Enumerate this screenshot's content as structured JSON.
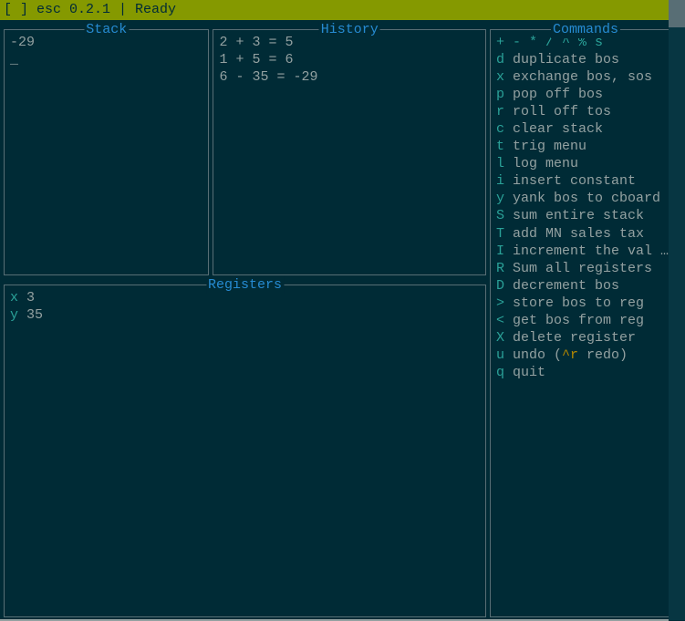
{
  "status": {
    "text": "[ ] esc 0.2.1 | Ready"
  },
  "panels": {
    "stack_title": "Stack",
    "history_title": "History",
    "registers_title": "Registers",
    "commands_title": "Commands"
  },
  "stack": {
    "lines": [
      "-29"
    ],
    "cursor": "_"
  },
  "history": {
    "lines": [
      "2 + 3 = 5",
      "1 + 5 = 6",
      "6 - 35 = -29"
    ]
  },
  "registers": [
    {
      "key": "x",
      "value": "3"
    },
    {
      "key": "y",
      "value": "35"
    }
  ],
  "commands": {
    "operators": "+ - * / ^ % s",
    "items": [
      {
        "key": "d",
        "desc": "duplicate bos"
      },
      {
        "key": "x",
        "desc": "exchange bos, sos"
      },
      {
        "key": "p",
        "desc": "pop off bos"
      },
      {
        "key": "r",
        "desc": "roll off tos"
      },
      {
        "key": "c",
        "desc": "clear stack"
      },
      {
        "key": "t",
        "desc": "trig menu"
      },
      {
        "key": "l",
        "desc": "log menu"
      },
      {
        "key": "i",
        "desc": "insert constant"
      },
      {
        "key": "y",
        "desc": "yank bos to cboard"
      },
      {
        "key": "S",
        "desc": "sum entire stack"
      },
      {
        "key": "T",
        "desc": "add MN sales tax"
      },
      {
        "key": "I",
        "desc": "increment the val …"
      },
      {
        "key": "R",
        "desc": "Sum all registers"
      },
      {
        "key": "D",
        "desc": "decrement bos"
      },
      {
        "key": ">",
        "desc": "store bos to reg"
      },
      {
        "key": "<",
        "desc": "get bos from reg"
      },
      {
        "key": "X",
        "desc": "delete register"
      }
    ],
    "undo": {
      "key": "u",
      "prefix": "undo (",
      "redo_key": "^r",
      "suffix": " redo)"
    },
    "quit": {
      "key": "q",
      "desc": "quit"
    }
  }
}
